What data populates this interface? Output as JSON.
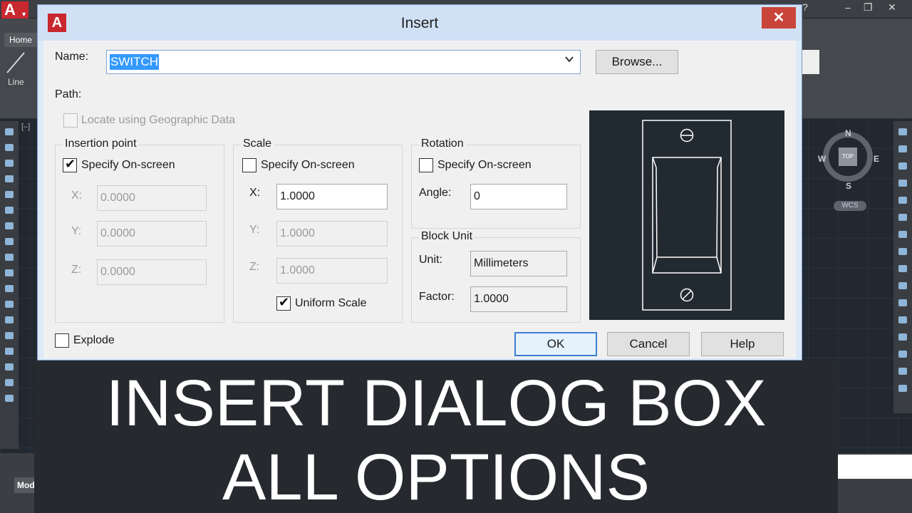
{
  "acad": {
    "ribbon_tab": "Home",
    "line_tool_label": "Line",
    "model_tab": "Mod",
    "viewcube": {
      "top": "TOP",
      "n": "N",
      "s": "S",
      "e": "E",
      "w": "W",
      "wcs": "WCS"
    }
  },
  "dialog": {
    "title": "Insert",
    "name_label": "Name:",
    "name_value": "SWITCH",
    "browse_label": "Browse...",
    "path_label": "Path:",
    "geo_label": "Locate using Geographic Data",
    "insertion": {
      "title": "Insertion point",
      "specify_label": "Specify On-screen",
      "specify_checked": true,
      "x_label": "X:",
      "x_value": "0.0000",
      "y_label": "Y:",
      "y_value": "0.0000",
      "z_label": "Z:",
      "z_value": "0.0000"
    },
    "scale": {
      "title": "Scale",
      "specify_label": "Specify On-screen",
      "specify_checked": false,
      "x_label": "X:",
      "x_value": "1.0000",
      "y_label": "Y:",
      "y_value": "1.0000",
      "z_label": "Z:",
      "z_value": "1.0000",
      "uniform_label": "Uniform Scale",
      "uniform_checked": true
    },
    "rotation": {
      "title": "Rotation",
      "specify_label": "Specify On-screen",
      "specify_checked": false,
      "angle_label": "Angle:",
      "angle_value": "0"
    },
    "block_unit": {
      "title": "Block Unit",
      "unit_label": "Unit:",
      "unit_value": "Millimeters",
      "factor_label": "Factor:",
      "factor_value": "1.0000"
    },
    "explode_label": "Explode",
    "ok_label": "OK",
    "cancel_label": "Cancel",
    "help_label": "Help",
    "close_glyph": "✕"
  },
  "banner": {
    "line1": "INSERT DIALOG BOX",
    "line2": "ALL OPTIONS"
  }
}
